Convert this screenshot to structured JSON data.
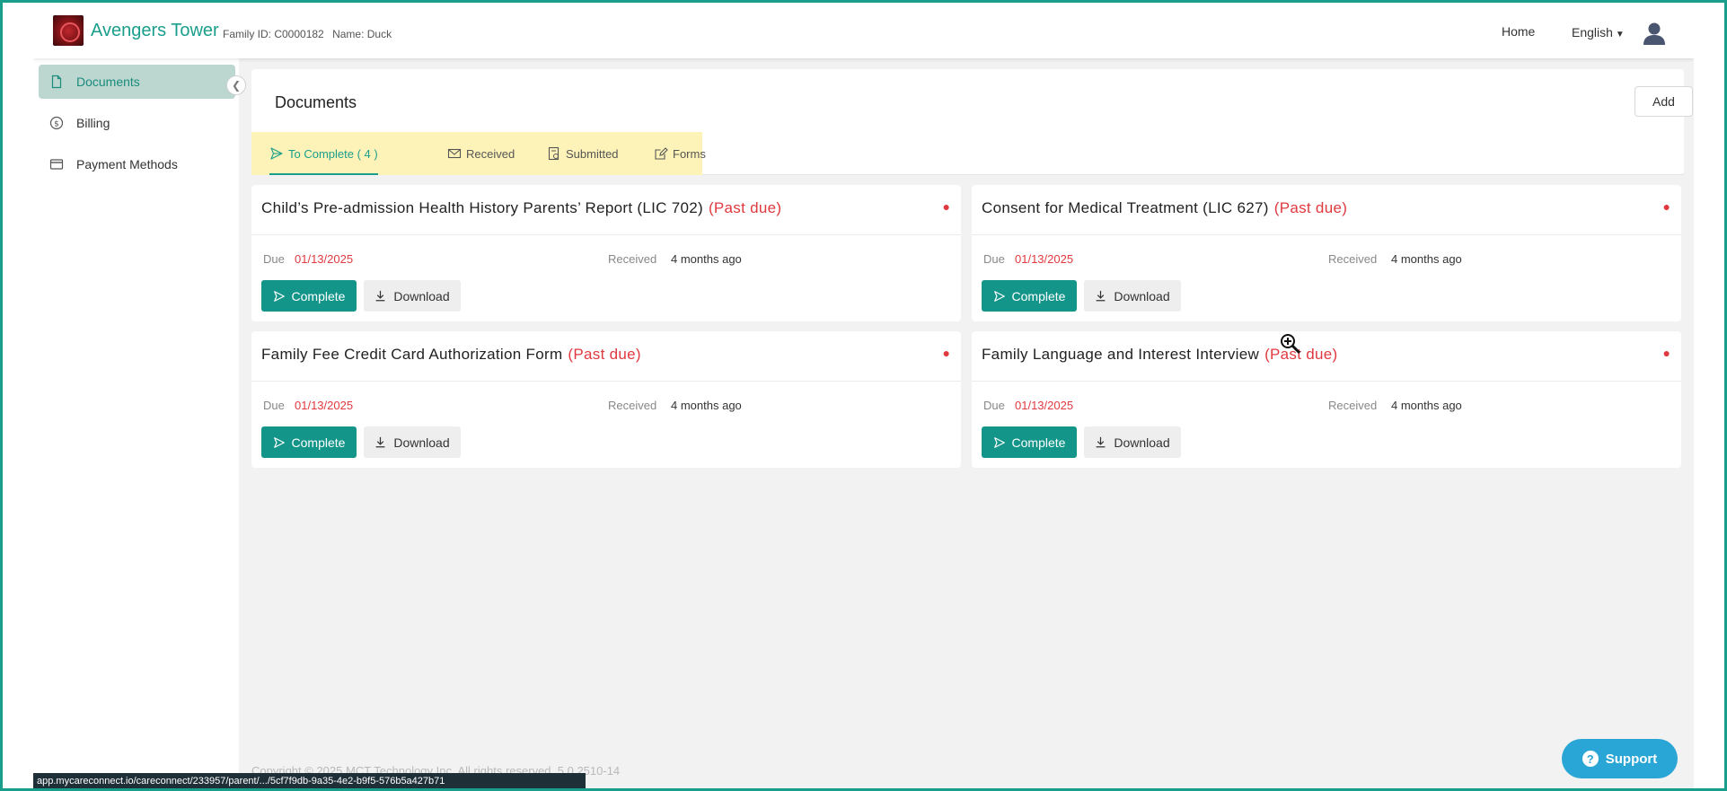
{
  "header": {
    "brand": "Avengers Tower",
    "family_id": "Family ID: C0000182",
    "family_name": "Name: Duck",
    "home_label": "Home",
    "language": "English"
  },
  "sidebar": {
    "items": [
      {
        "label": "Documents",
        "icon": "document-icon",
        "active": true
      },
      {
        "label": "Billing",
        "icon": "dollar-circle-icon",
        "active": false
      },
      {
        "label": "Payment Methods",
        "icon": "credit-card-icon",
        "active": false
      }
    ]
  },
  "main": {
    "title": "Documents",
    "add_label": "Add",
    "tabs": [
      {
        "label": "To Complete ( 4 )",
        "icon": "send-icon",
        "active": true
      },
      {
        "label": "Received",
        "icon": "envelope-icon",
        "active": false
      },
      {
        "label": "Submitted",
        "icon": "submitted-doc-icon",
        "active": false
      },
      {
        "label": "Forms",
        "icon": "edit-icon",
        "active": false
      }
    ],
    "cards": [
      {
        "title": "Child’s Pre-admission Health History Parents’ Report (LIC 702)",
        "status": "(Past due)",
        "due_label": "Due",
        "due_date": "01/13/2025",
        "received_label": "Received",
        "received_value": "4 months ago",
        "complete_label": "Complete",
        "download_label": "Download"
      },
      {
        "title": "Consent for Medical Treatment (LIC 627)",
        "status": "(Past due)",
        "due_label": "Due",
        "due_date": "01/13/2025",
        "received_label": "Received",
        "received_value": "4 months ago",
        "complete_label": "Complete",
        "download_label": "Download"
      },
      {
        "title": "Family Fee Credit Card Authorization Form",
        "status": "(Past due)",
        "due_label": "Due",
        "due_date": "01/13/2025",
        "received_label": "Received",
        "received_value": "4 months ago",
        "complete_label": "Complete",
        "download_label": "Download"
      },
      {
        "title": "Family Language and Interest Interview",
        "status": "(Past due)",
        "due_label": "Due",
        "due_date": "01/13/2025",
        "received_label": "Received",
        "received_value": "4 months ago",
        "complete_label": "Complete",
        "download_label": "Download"
      }
    ]
  },
  "footer": {
    "copyright": "Copyright © 2025 MCT Technology Inc. All rights reserved. 5.0.2510-14"
  },
  "statusbar": {
    "url": "app.mycareconnect.io/careconnect/233957/parent/.../5cf7f9db-9a35-4e2-b9f5-576b5a427b71"
  },
  "support": {
    "label": "Support"
  },
  "colors": {
    "accent": "#1a9e8c",
    "button": "#13958a",
    "past_due": "#e0393f",
    "tab_highlight": "#fdf3b8",
    "support": "#2aa6d6"
  }
}
